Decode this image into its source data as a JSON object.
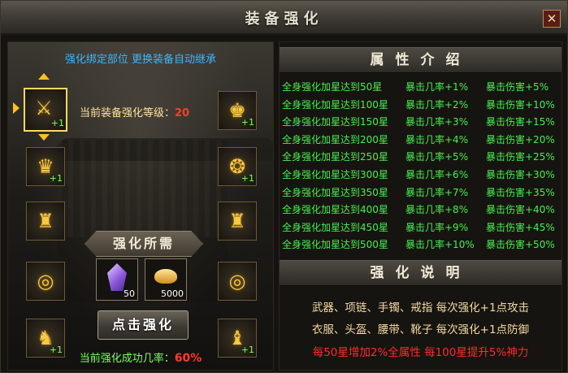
{
  "window": {
    "title": "装备强化",
    "close_icon": "close-icon"
  },
  "left": {
    "inherit_note": "强化绑定部位 更换装备自动继承",
    "current_level_label": "当前装备强化等级：",
    "current_level_value": "20",
    "slots_left": [
      {
        "name": "weapon",
        "icon": "⚔",
        "level": "+1"
      },
      {
        "name": "helmet",
        "icon": "♛",
        "level": "+1"
      },
      {
        "name": "bracelet",
        "icon": "♜",
        "level": ""
      },
      {
        "name": "ring",
        "icon": "◎",
        "level": ""
      },
      {
        "name": "belt",
        "icon": "♞",
        "level": "+1"
      }
    ],
    "slots_right": [
      {
        "name": "armor",
        "icon": "♚",
        "level": "+1"
      },
      {
        "name": "necklace",
        "icon": "❂",
        "level": "+1"
      },
      {
        "name": "bracelet-right",
        "icon": "♜",
        "level": ""
      },
      {
        "name": "ring-right",
        "icon": "◎",
        "level": ""
      },
      {
        "name": "boots",
        "icon": "♝",
        "level": "+1"
      }
    ],
    "requirement_title": "强化所需",
    "materials": [
      {
        "name": "purple-gem",
        "qty": "50"
      },
      {
        "name": "gold-ingot",
        "qty": "5000"
      }
    ],
    "strengthen_button": "点击强化",
    "success_rate_label": "当前强化成功几率：",
    "success_rate_value": "60%"
  },
  "right": {
    "attributes_title": "属性介绍",
    "attributes": [
      {
        "stars": "全身强化加星达到50星",
        "crit_rate": "暴击几率+1%",
        "crit_dmg": "暴击伤害+5%"
      },
      {
        "stars": "全身强化加星达到100星",
        "crit_rate": "暴击几率+2%",
        "crit_dmg": "暴击伤害+10%"
      },
      {
        "stars": "全身强化加星达到150星",
        "crit_rate": "暴击几率+3%",
        "crit_dmg": "暴击伤害+15%"
      },
      {
        "stars": "全身强化加星达到200星",
        "crit_rate": "暴击几率+4%",
        "crit_dmg": "暴击伤害+20%"
      },
      {
        "stars": "全身强化加星达到250星",
        "crit_rate": "暴击几率+5%",
        "crit_dmg": "暴击伤害+25%"
      },
      {
        "stars": "全身强化加星达到300星",
        "crit_rate": "暴击几率+6%",
        "crit_dmg": "暴击伤害+30%"
      },
      {
        "stars": "全身强化加星达到350星",
        "crit_rate": "暴击几率+7%",
        "crit_dmg": "暴击伤害+35%"
      },
      {
        "stars": "全身强化加星达到400星",
        "crit_rate": "暴击几率+8%",
        "crit_dmg": "暴击伤害+40%"
      },
      {
        "stars": "全身强化加星达到450星",
        "crit_rate": "暴击几率+9%",
        "crit_dmg": "暴击伤害+45%"
      },
      {
        "stars": "全身强化加星达到500星",
        "crit_rate": "暴击几率+10%",
        "crit_dmg": "暴击伤害+50%"
      }
    ],
    "explain_title": "强化说明",
    "explain_lines": [
      "武器、项链、手镯、戒指  每次强化+1点攻击",
      "衣服、头盔、腰带、靴子  每次强化+1点防御",
      "每50星增加2%全属性  每100星提升5%神力"
    ]
  },
  "colors": {
    "accent_gold": "#ffd865",
    "stat_green": "#49ee52",
    "warn_red": "#ff2b2b",
    "note_blue": "#3ab6ff"
  }
}
